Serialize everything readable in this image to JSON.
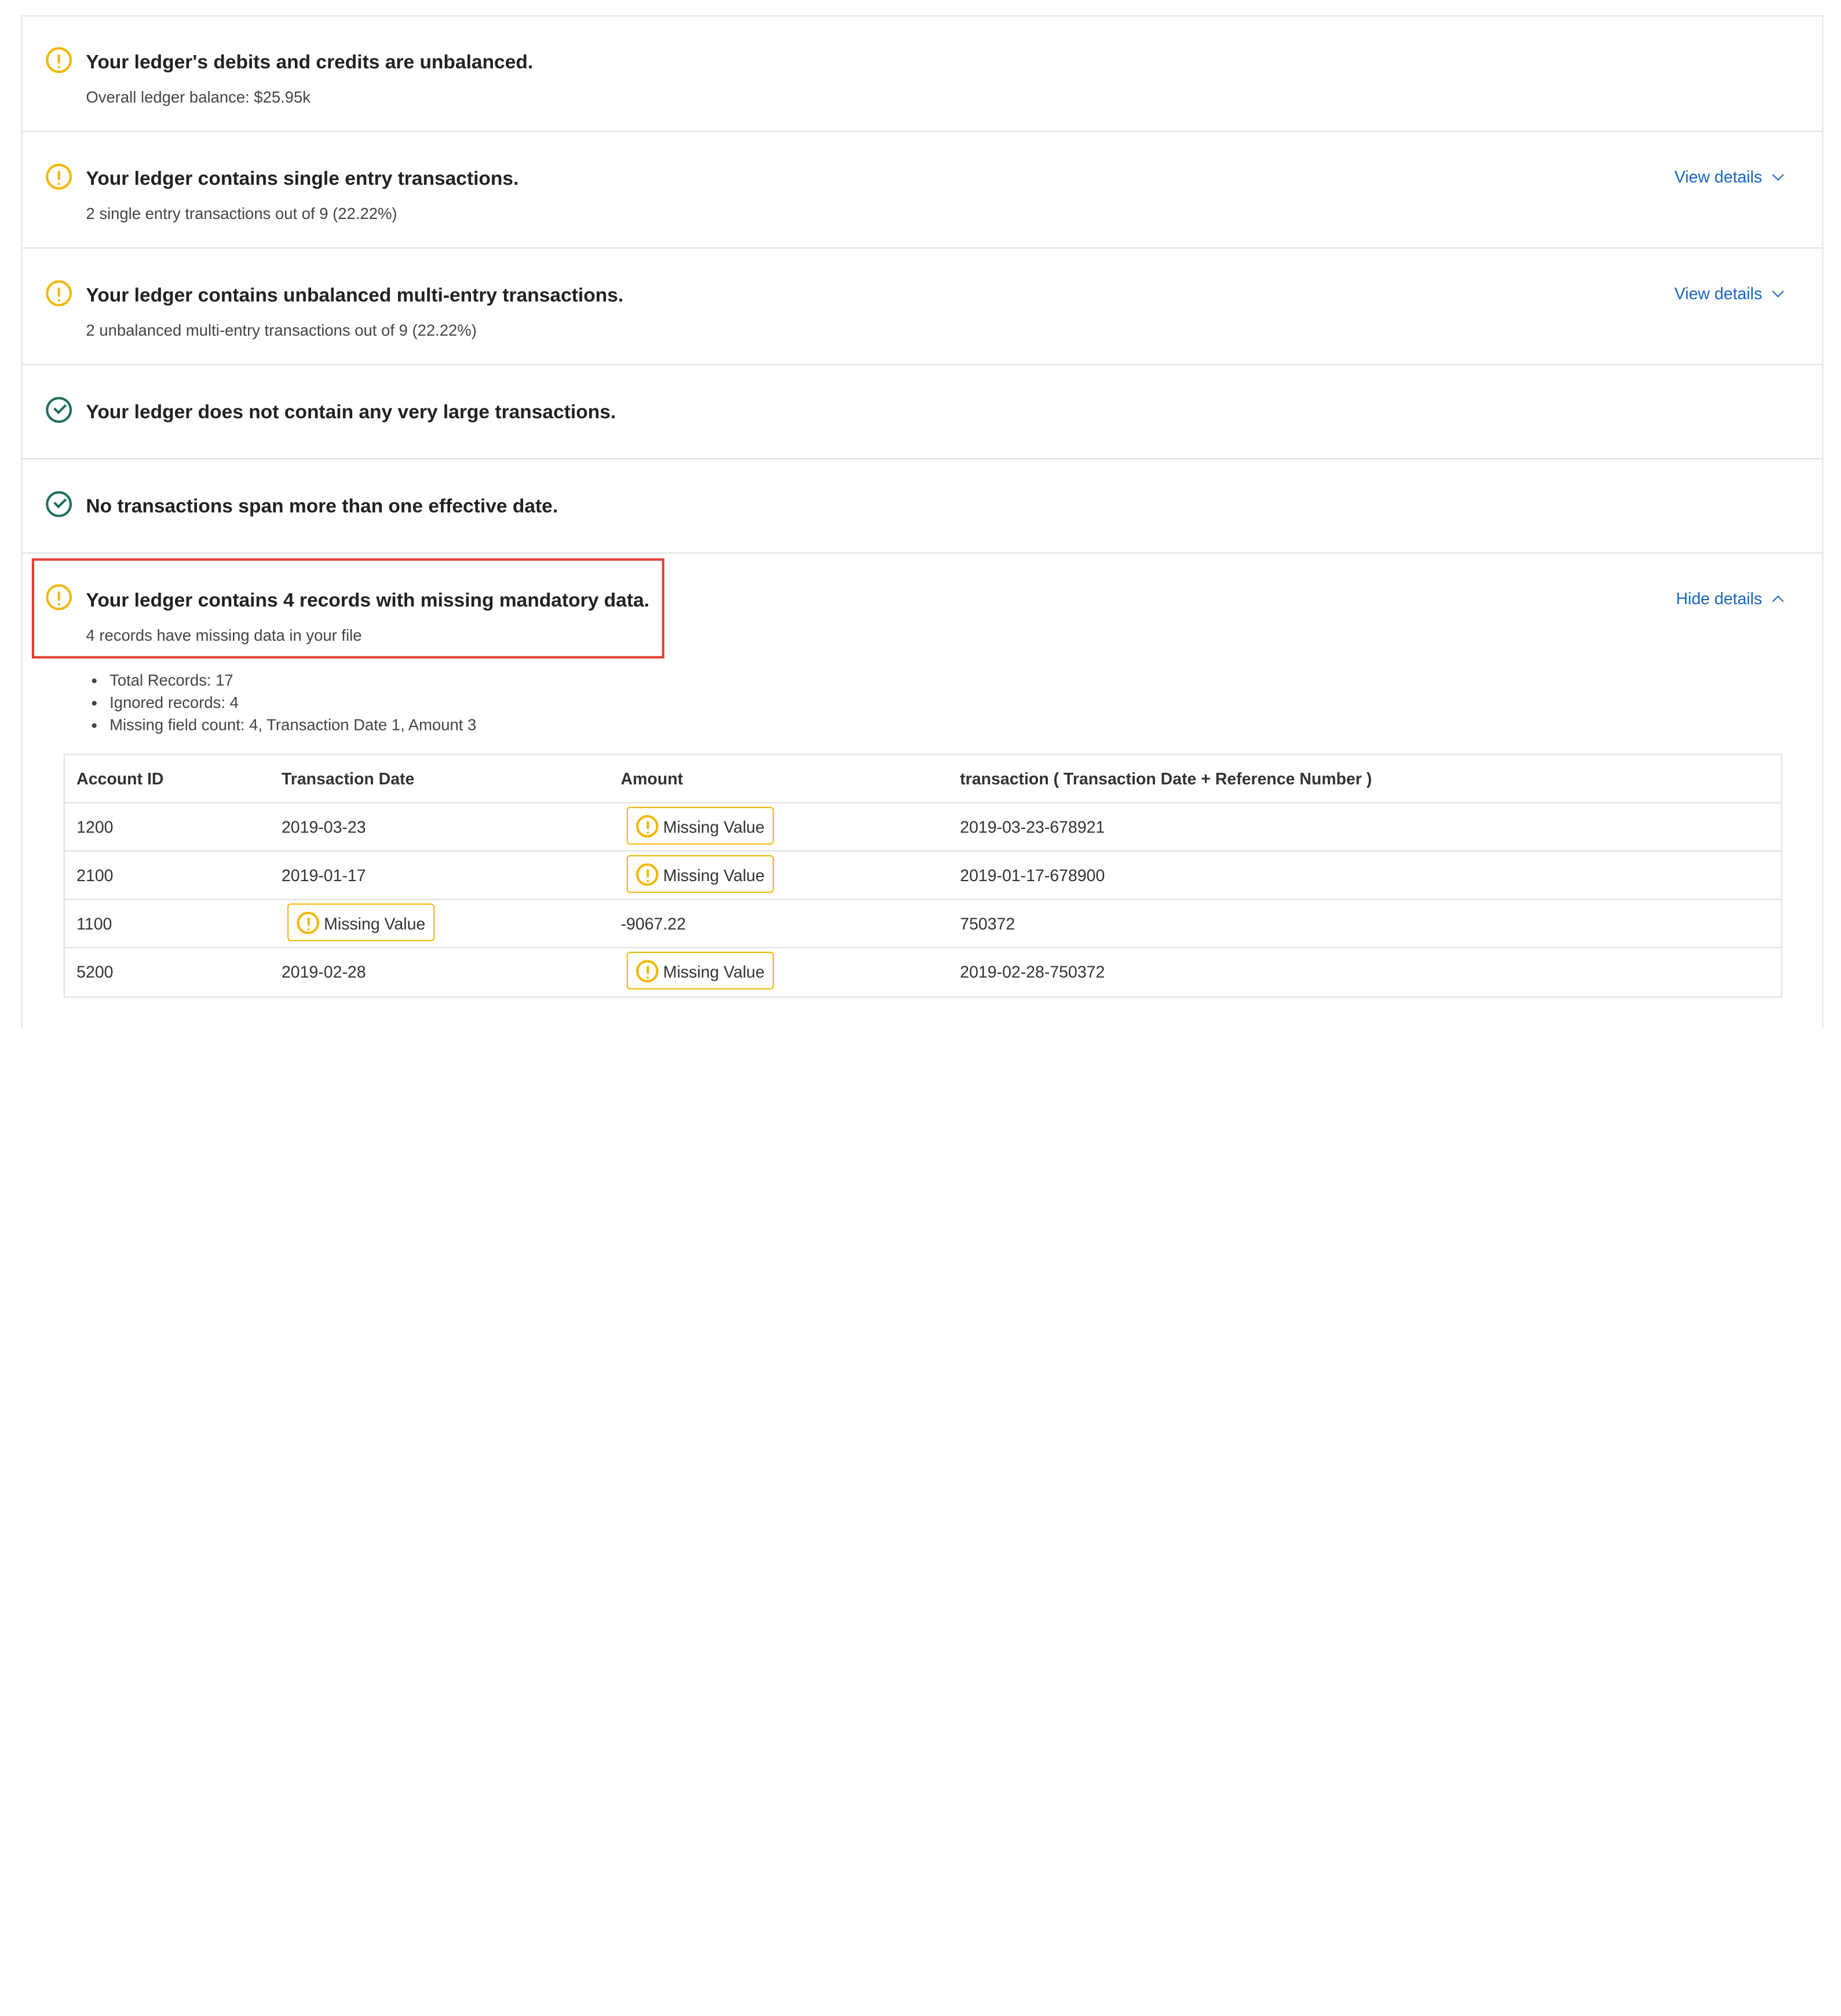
{
  "checks": [
    {
      "status": "warning",
      "title": "Your ledger's debits and credits are unbalanced.",
      "subtitle": "Overall ledger balance: $25.95k",
      "link": ""
    },
    {
      "status": "warning",
      "title": "Your ledger contains single entry transactions.",
      "subtitle": "2 single entry transactions out of 9 (22.22%)",
      "link": "View details"
    },
    {
      "status": "warning",
      "title": "Your ledger contains unbalanced multi-entry transactions.",
      "subtitle": "2 unbalanced multi-entry transactions out of 9 (22.22%)",
      "link": "View details"
    },
    {
      "status": "ok",
      "title": "Your ledger does not contain any very large transactions.",
      "subtitle": "",
      "link": ""
    },
    {
      "status": "ok",
      "title": "No transactions span more than one effective date.",
      "subtitle": "",
      "link": ""
    },
    {
      "status": "warning",
      "title": "Your ledger contains 4 records with missing mandatory data.",
      "subtitle": "4 records have missing data in your file",
      "link": "Hide details"
    }
  ],
  "details": {
    "stats": [
      "Total Records: 17",
      "Ignored records: 4",
      "Missing field count: 4, Transaction Date 1, Amount 3"
    ],
    "missing_label": "Missing Value",
    "columns": [
      "Account ID",
      "Transaction Date",
      "Amount",
      "transaction ( Transaction Date + Reference Number )"
    ],
    "rows": [
      {
        "account": "1200",
        "date": "2019-03-23",
        "amount": "Missing Value",
        "transaction": "2019-03-23-678921"
      },
      {
        "account": "2100",
        "date": "2019-01-17",
        "amount": "Missing Value",
        "transaction": "2019-01-17-678900"
      },
      {
        "account": "1100",
        "date": "Missing Value",
        "amount": "-9067.22",
        "transaction": "750372"
      },
      {
        "account": "5200",
        "date": "2019-02-28",
        "amount": "Missing Value",
        "transaction": "2019-02-28-750372"
      }
    ]
  },
  "colors": {
    "warning": "#f2b600",
    "ok": "#1f6e5f",
    "link": "#1565c0",
    "highlight": "#e0402e"
  }
}
